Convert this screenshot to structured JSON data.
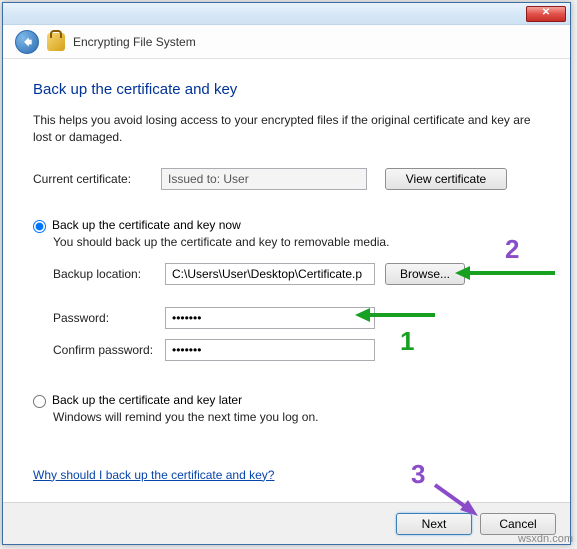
{
  "window": {
    "title": "Encrypting File System",
    "close_glyph": "✕"
  },
  "page": {
    "heading": "Back up the certificate and key",
    "help_text": "This helps you avoid losing access to your encrypted files if the original certificate and key are lost or damaged."
  },
  "current_cert": {
    "label": "Current certificate:",
    "value": "Issued to: User",
    "view_button": "View certificate"
  },
  "option_now": {
    "label": "Back up the certificate and key now",
    "desc": "You should back up the certificate and key to removable media.",
    "selected": true
  },
  "backup": {
    "location_label": "Backup location:",
    "location_value": "C:\\Users\\User\\Desktop\\Certificate.p",
    "browse_button": "Browse...",
    "password_label": "Password:",
    "password_value": "•••••••",
    "confirm_label": "Confirm password:",
    "confirm_value": "•••••••"
  },
  "option_later": {
    "label": "Back up the certificate and key later",
    "desc": "Windows will remind you the next time you log on.",
    "selected": false
  },
  "help_link": "Why should I back up the certificate and key?",
  "footer": {
    "next": "Next",
    "cancel": "Cancel"
  },
  "annotations": {
    "n1": "1",
    "n2": "2",
    "n3": "3"
  },
  "watermark": "wsxdn.com"
}
